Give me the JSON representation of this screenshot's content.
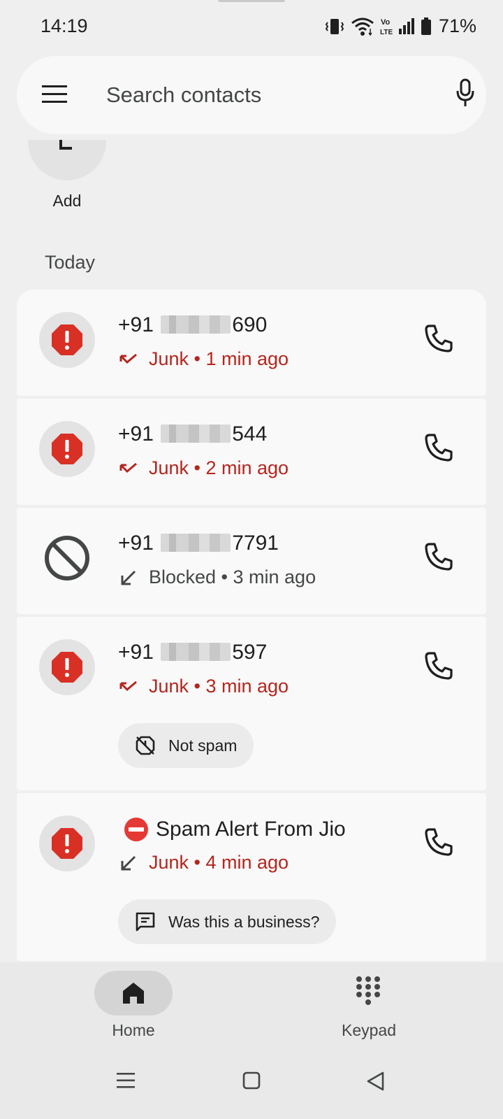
{
  "status_bar": {
    "time": "14:19",
    "battery_percent": "71%",
    "icons": [
      "vibrate-icon",
      "wifi-icon",
      "volte-icon",
      "signal-icon",
      "battery-icon"
    ],
    "volte_text_top": "Vo",
    "volte_text_bottom": "LTE"
  },
  "search": {
    "placeholder": "Search contacts"
  },
  "favorites": {
    "add_label": "Add"
  },
  "section_label": "Today",
  "calls": [
    {
      "number_prefix": "+91 ",
      "number_suffix": "690",
      "status": "Junk • 1 min ago",
      "type": "junk"
    },
    {
      "number_prefix": "+91 ",
      "number_suffix": "544",
      "status": "Junk • 2 min ago",
      "type": "junk"
    },
    {
      "number_prefix": "+91 ",
      "number_suffix": "7791",
      "status": "Blocked • 3 min ago",
      "type": "blocked"
    },
    {
      "number_prefix": "+91 ",
      "number_suffix": "597",
      "status": "Junk • 3 min ago",
      "type": "junk",
      "chip": "Not spam"
    },
    {
      "name": "Spam Alert From Jio",
      "status": "Junk • 4 min ago",
      "type": "junk",
      "chip": "Was this a business?"
    }
  ],
  "bottom_nav": {
    "home_label": "Home",
    "keypad_label": "Keypad"
  },
  "colors": {
    "junk_red": "#b3261e",
    "alert_red": "#d93025",
    "background": "#efefef",
    "card": "#f9f9f9"
  }
}
